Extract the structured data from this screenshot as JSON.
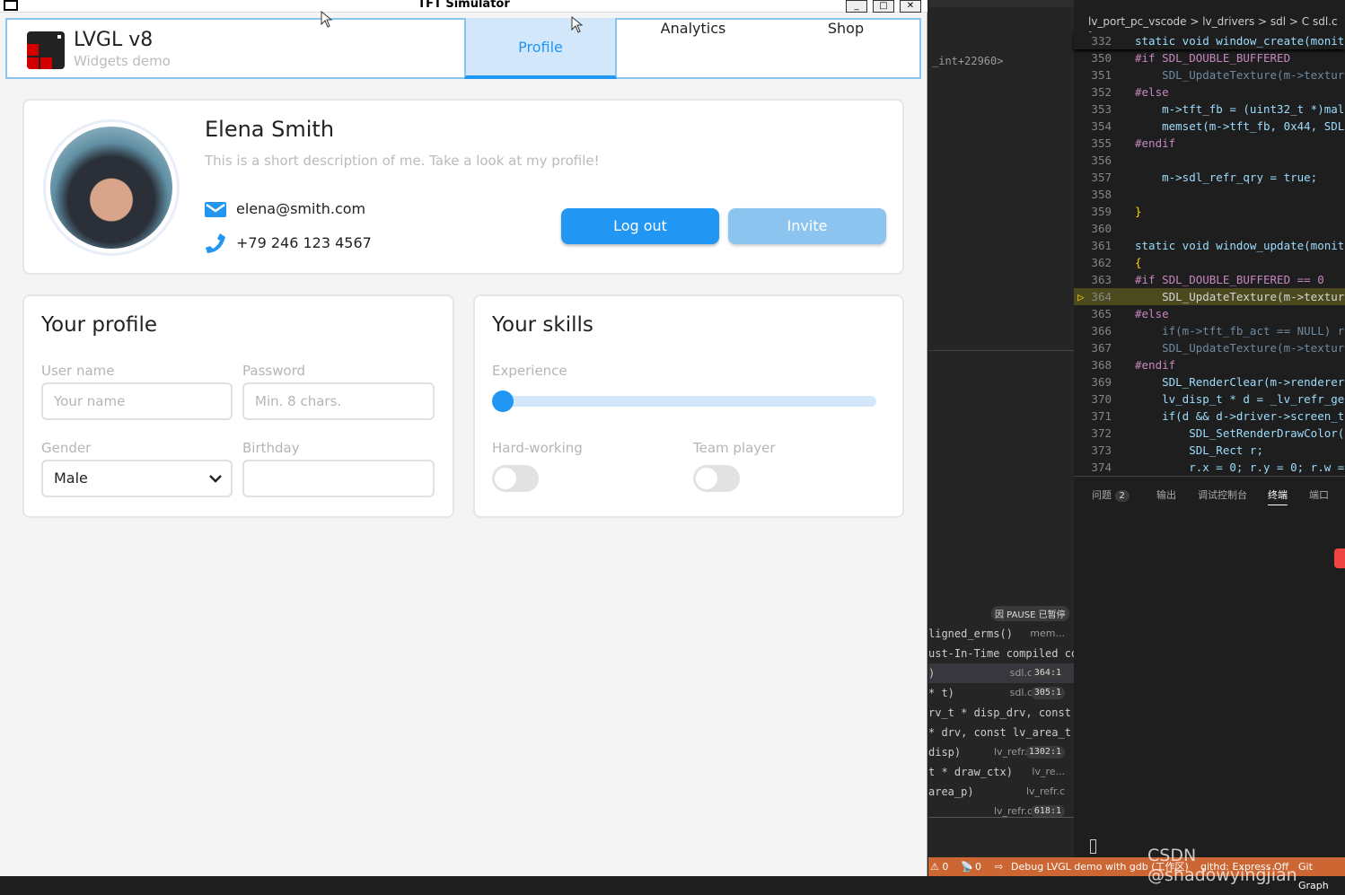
{
  "simulator": {
    "title": "TFT Simulator",
    "buttons": [
      "_",
      "□",
      "✕"
    ]
  },
  "header": {
    "app_name": "LVGL v8",
    "app_subtitle": "Widgets demo",
    "tabs": [
      {
        "label": "Profile",
        "active": true
      },
      {
        "label": "Analytics"
      },
      {
        "label": "Shop"
      }
    ]
  },
  "profile": {
    "name": "Elena Smith",
    "description": "This is a short description of me. Take a look at my profile!",
    "email": "elena@smith.com",
    "phone": "+79 246 123 4567",
    "logout_label": "Log out",
    "invite_label": "Invite"
  },
  "your_profile": {
    "title": "Your profile",
    "username_label": "User name",
    "username_placeholder": "Your name",
    "password_label": "Password",
    "password_placeholder": "Min. 8 chars.",
    "gender_label": "Gender",
    "gender_value": "Male",
    "birthday_label": "Birthday",
    "birthday_value": ""
  },
  "your_skills": {
    "title": "Your skills",
    "experience_label": "Experience",
    "experience_value": 0,
    "hardworking_label": "Hard-working",
    "hardworking_on": false,
    "teamplayer_label": "Team player",
    "teamplayer_on": false
  },
  "colors": {
    "primary": "#2196f3",
    "primary_light": "#8cc4f0",
    "status_bar": "#cc6633"
  },
  "vscode": {
    "left_top_text": "_int+22960>",
    "breadcrumb": "lv_port_pc_vscode > lv_drivers > sdl > C sdl.c >",
    "code": [
      {
        "n": "332",
        "t": "static void window_create(monit"
      },
      {
        "n": "350",
        "t": "#if SDL_DOUBLE_BUFFERED",
        "c": "pp"
      },
      {
        "n": "351",
        "t": "    SDL_UpdateTexture(m->textur",
        "c": "dim"
      },
      {
        "n": "352",
        "t": "#else",
        "c": "pp"
      },
      {
        "n": "353",
        "t": "    m->tft_fb = (uint32_t *)mal"
      },
      {
        "n": "354",
        "t": "    memset(m->tft_fb, 0x44, SDL"
      },
      {
        "n": "355",
        "t": "#endif",
        "c": "pp"
      },
      {
        "n": "356",
        "t": ""
      },
      {
        "n": "357",
        "t": "    m->sdl_refr_qry = true;"
      },
      {
        "n": "358",
        "t": ""
      },
      {
        "n": "359",
        "t": "}",
        "c": "br"
      },
      {
        "n": "360",
        "t": ""
      },
      {
        "n": "361",
        "t": "static void window_update(monit"
      },
      {
        "n": "362",
        "t": "{",
        "c": "br"
      },
      {
        "n": "363",
        "t": "#if SDL_DOUBLE_BUFFERED == 0",
        "c": "pp"
      },
      {
        "n": "364",
        "t": "    SDL_UpdateTexture(m->textur",
        "c": "hl"
      },
      {
        "n": "365",
        "t": "#else",
        "c": "pp"
      },
      {
        "n": "366",
        "t": "    if(m->tft_fb_act == NULL) r",
        "c": "dim"
      },
      {
        "n": "367",
        "t": "    SDL_UpdateTexture(m->textur",
        "c": "dim"
      },
      {
        "n": "368",
        "t": "#endif",
        "c": "pp"
      },
      {
        "n": "369",
        "t": "    SDL_RenderClear(m->renderer"
      },
      {
        "n": "370",
        "t": "    lv_disp_t * d = _lv_refr_ge"
      },
      {
        "n": "371",
        "t": "    if(d && d->driver->screen_t"
      },
      {
        "n": "372",
        "t": "        SDL_SetRenderDrawColor("
      },
      {
        "n": "373",
        "t": "        SDL_Rect r;"
      },
      {
        "n": "374",
        "t": "        r.x = 0; r.y = 0; r.w ="
      }
    ],
    "panel_tabs": [
      {
        "label": "问题",
        "badge": "2"
      },
      {
        "label": "输出"
      },
      {
        "label": "调试控制台"
      },
      {
        "label": "终端",
        "active": true
      },
      {
        "label": "端口"
      }
    ],
    "pause_badge": "因 PAUSE 已暂停",
    "call_stack": [
      {
        "fn": "ligned_erms()",
        "file": "mem..."
      },
      {
        "fn": "ust-In-Time compiled co",
        "file": ""
      },
      {
        "fn": ")",
        "file": "sdl.c",
        "pos": "364:1",
        "active": true
      },
      {
        "fn": " * t)",
        "file": "sdl.c",
        "pos": "305:1"
      },
      {
        "fn": "rv_t * disp_drv, const",
        "file": ""
      },
      {
        "fn": " * drv, const lv_area_t",
        "file": ""
      },
      {
        "fn": "disp)",
        "file": "lv_refr.c",
        "pos": "1302:1"
      },
      {
        "fn": "t * draw_ctx)",
        "file": "lv_re..."
      },
      {
        "fn": " area_p)",
        "file": "lv_refr.c"
      },
      {
        "fn": "",
        "file": "lv_refr.c",
        "pos": "618:1"
      }
    ],
    "status": {
      "warnings": "⚠ 0",
      "ports": "0",
      "debug": "Debug LVGL demo with gdb (工作区)",
      "githd": "githd: Express Off",
      "gitgraph": "Git Graph"
    },
    "watermark": "CSDN @shadowyingjian"
  }
}
